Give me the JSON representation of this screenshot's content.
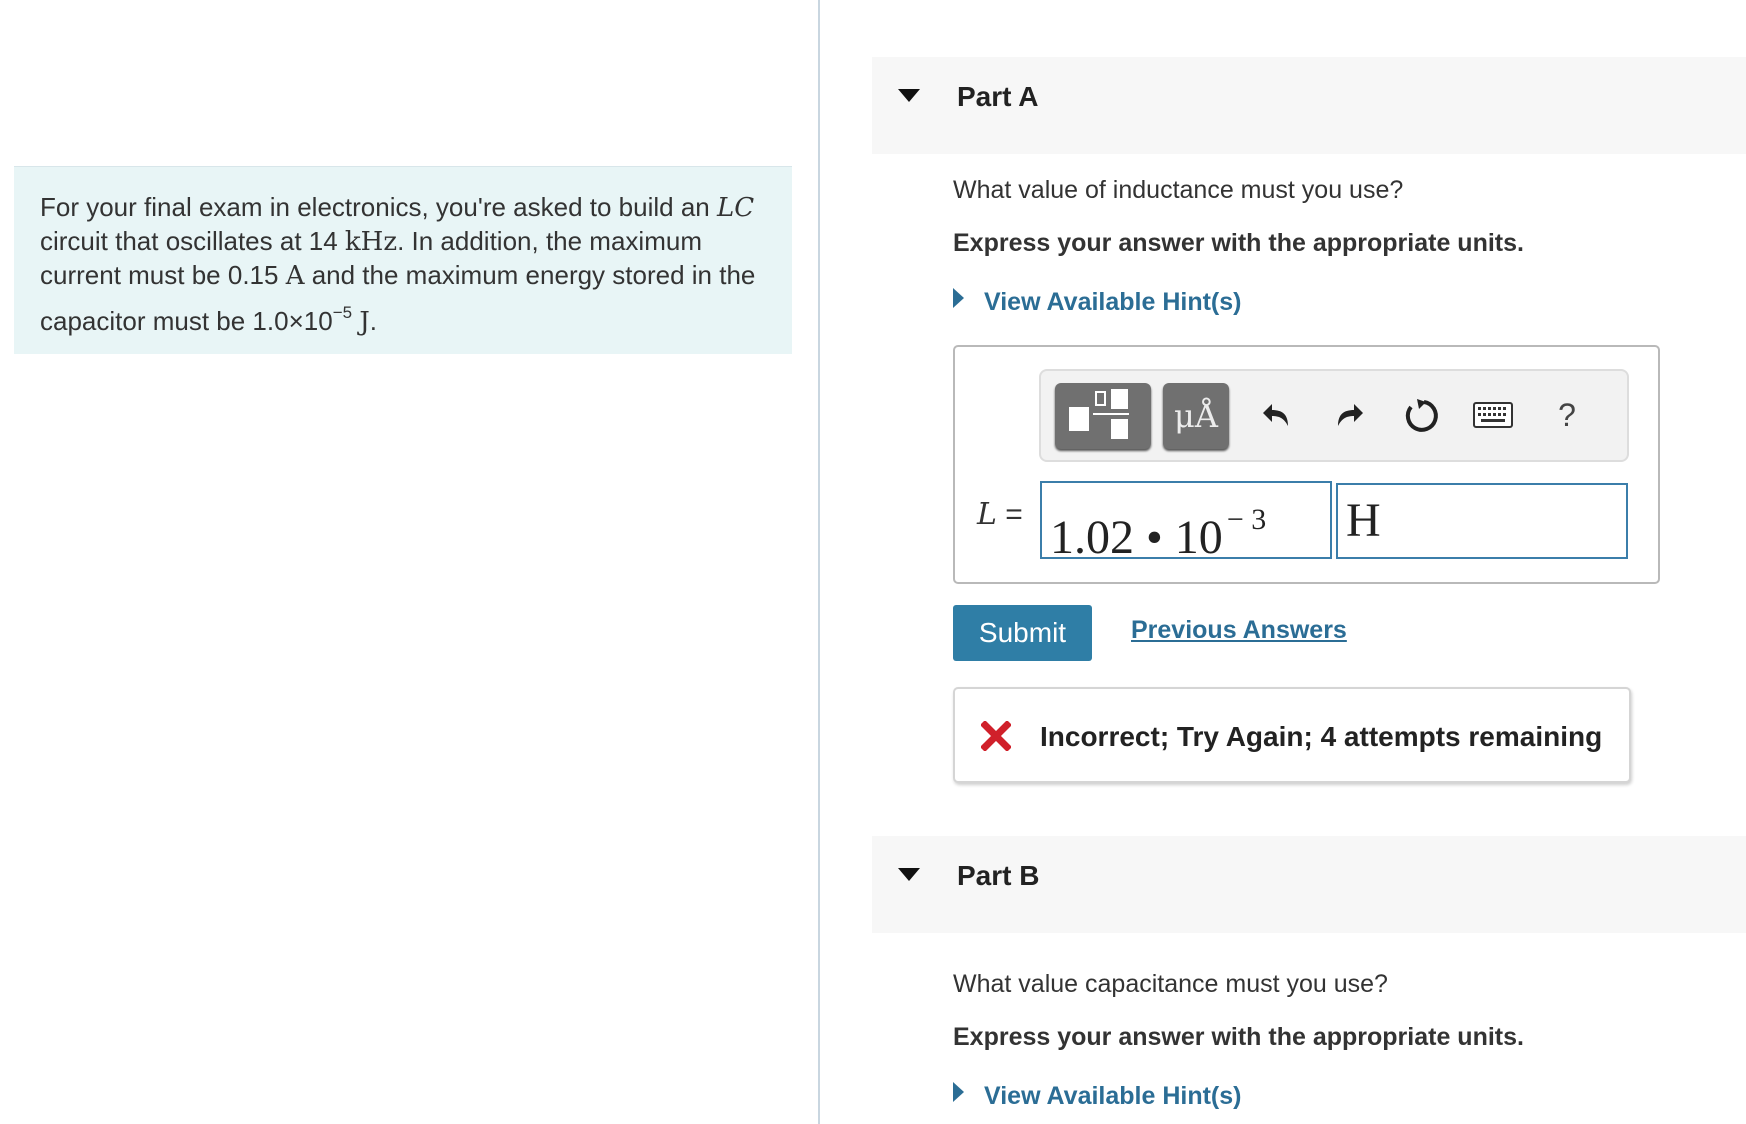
{
  "problem": {
    "text1": "For your final exam in electronics, you're asked to build an ",
    "math_lc": "LC",
    "text2": "circuit that oscillates at 14 ",
    "unit_khz": "kHz",
    "text3": ". In addition, the maximum",
    "text4": "current must be 0.15 ",
    "unit_a": "A",
    "text5": " and the maximum energy stored in the",
    "text6": "capacitor must be 1.0×10",
    "exp": "−5",
    "unit_j": "J",
    "text7": "."
  },
  "part_a": {
    "title": "Part A",
    "question": "What value of inductance must you use?",
    "instruction": "Express your answer with the appropriate units.",
    "hint": "View Available Hint(s)",
    "variable": "L",
    "equals": "=",
    "value_mantissa": "1.02 • 10",
    "value_exponent": "− 3",
    "unit": "H",
    "units_button": "μÅ",
    "help": "?",
    "submit": "Submit",
    "previous_answers": "Previous Answers",
    "feedback": "Incorrect; Try Again; 4 attempts remaining"
  },
  "part_b": {
    "title": "Part B",
    "question": "What value capacitance must you use?",
    "instruction": "Express your answer with the appropriate units.",
    "hint": "View Available Hint(s)"
  },
  "colors": {
    "accent": "#2f7ea6",
    "link": "#2b6d95",
    "error": "#d0202a",
    "problem_bg": "#e8f5f6"
  }
}
